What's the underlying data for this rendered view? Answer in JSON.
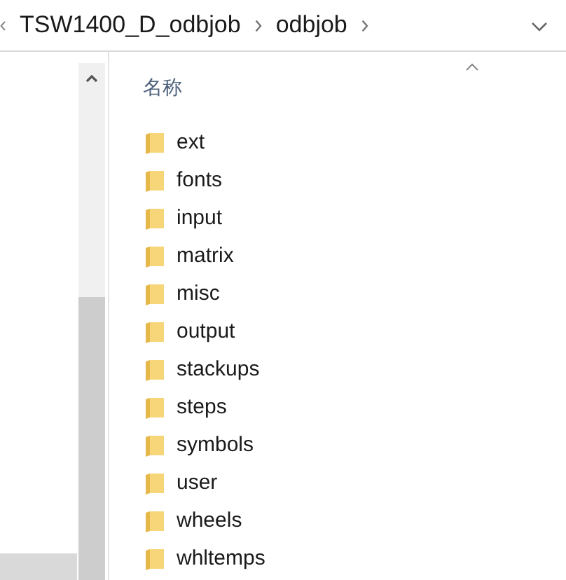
{
  "breadcrumb": [
    "TSW1400_D_odbjob",
    "odbjob"
  ],
  "column_header": "名称",
  "folders": [
    "ext",
    "fonts",
    "input",
    "matrix",
    "misc",
    "output",
    "stackups",
    "steps",
    "symbols",
    "user",
    "wheels",
    "whltemps"
  ]
}
